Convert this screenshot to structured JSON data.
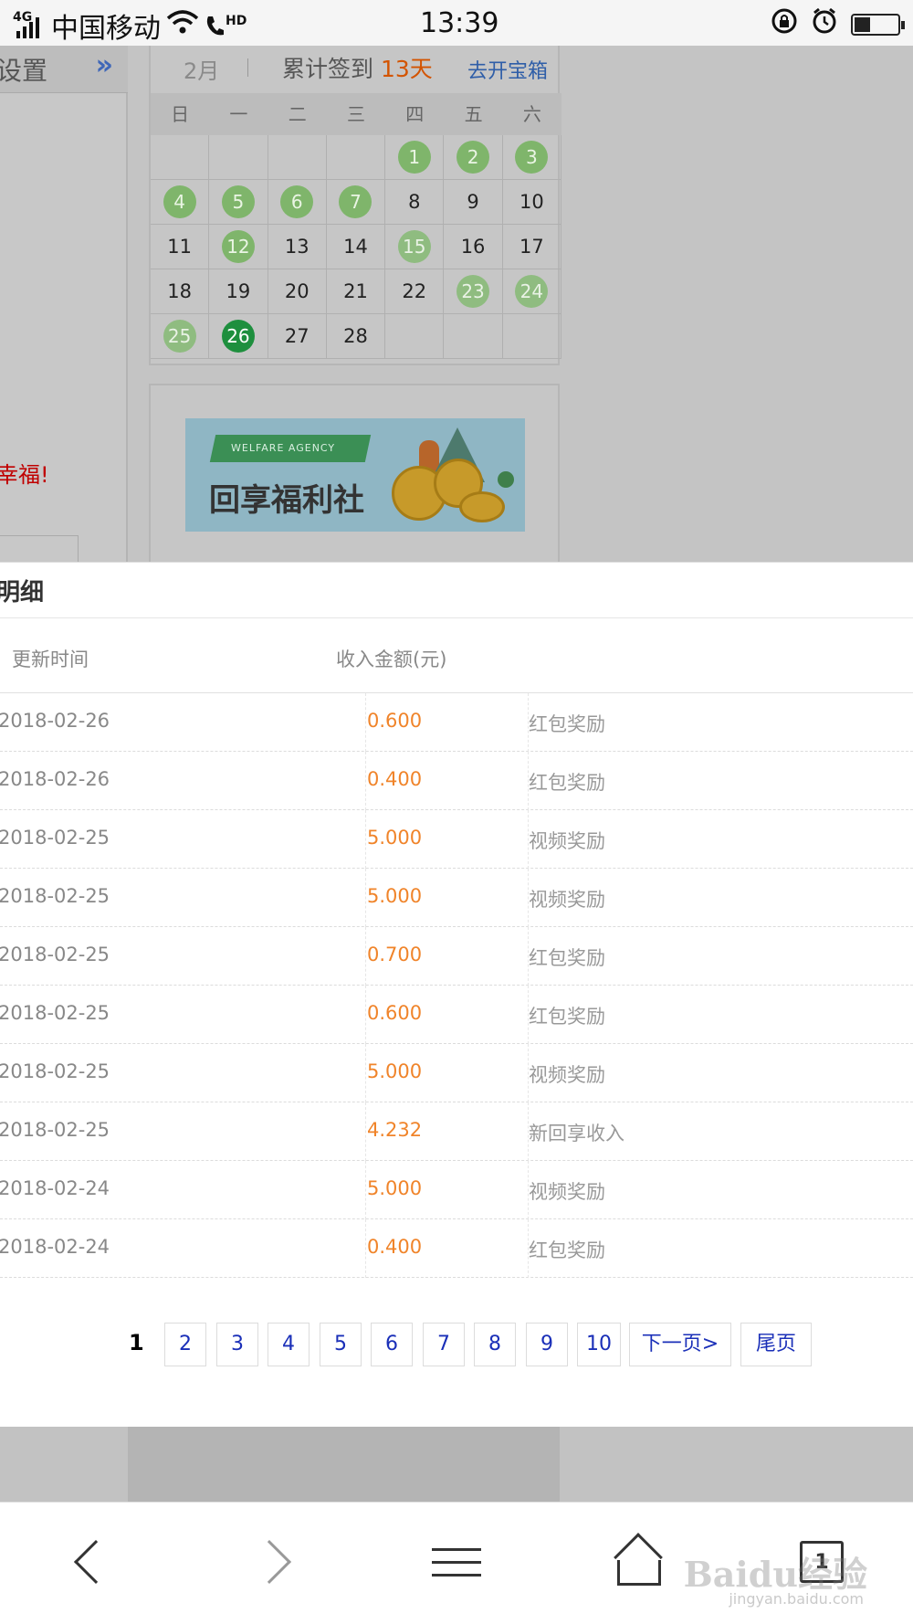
{
  "status_bar": {
    "signal_tag": "4G",
    "carrier": "中国移动",
    "hd_tag": "HD",
    "time": "13:39",
    "battery_fill": 0.35
  },
  "background_page": {
    "settings_label": "设置",
    "expand_glyph": "»",
    "red_note": "幸福!",
    "calendar": {
      "month": "2月",
      "total_prefix": "累计签到 ",
      "total_days": "13天",
      "chest_link": "去开宝箱",
      "weekdays": [
        "日",
        "一",
        "二",
        "三",
        "四",
        "五",
        "六"
      ],
      "cells": [
        {
          "day": "",
          "signed": false
        },
        {
          "day": "",
          "signed": false
        },
        {
          "day": "",
          "signed": false
        },
        {
          "day": "",
          "signed": false
        },
        {
          "day": "1",
          "signed": true
        },
        {
          "day": "2",
          "signed": true
        },
        {
          "day": "3",
          "signed": true
        },
        {
          "day": "4",
          "signed": true
        },
        {
          "day": "5",
          "signed": true
        },
        {
          "day": "6",
          "signed": true
        },
        {
          "day": "7",
          "signed": true
        },
        {
          "day": "8",
          "signed": false
        },
        {
          "day": "9",
          "signed": false
        },
        {
          "day": "10",
          "signed": false
        },
        {
          "day": "11",
          "signed": false
        },
        {
          "day": "12",
          "signed": true
        },
        {
          "day": "13",
          "signed": false
        },
        {
          "day": "14",
          "signed": false
        },
        {
          "day": "15",
          "signed": true
        },
        {
          "day": "16",
          "signed": false
        },
        {
          "day": "17",
          "signed": false
        },
        {
          "day": "18",
          "signed": false
        },
        {
          "day": "19",
          "signed": false
        },
        {
          "day": "20",
          "signed": false
        },
        {
          "day": "21",
          "signed": false
        },
        {
          "day": "22",
          "signed": false
        },
        {
          "day": "23",
          "signed": true
        },
        {
          "day": "24",
          "signed": true
        },
        {
          "day": "25",
          "signed": true
        },
        {
          "day": "26",
          "signed": true,
          "today": true
        },
        {
          "day": "27",
          "signed": false
        },
        {
          "day": "28",
          "signed": false
        },
        {
          "day": "",
          "signed": false
        },
        {
          "day": "",
          "signed": false
        },
        {
          "day": "",
          "signed": false
        }
      ]
    },
    "banner": {
      "ribbon_text": "WELFARE AGENCY",
      "title": "回享福利社"
    }
  },
  "sheet": {
    "title": "明细",
    "columns": [
      "更新时间",
      "收入金额(元)"
    ],
    "rows": [
      {
        "date": "2018-02-26",
        "amount": "0.600",
        "type": "红包奖励"
      },
      {
        "date": "2018-02-26",
        "amount": "0.400",
        "type": "红包奖励"
      },
      {
        "date": "2018-02-25",
        "amount": "5.000",
        "type": "视频奖励"
      },
      {
        "date": "2018-02-25",
        "amount": "5.000",
        "type": "视频奖励"
      },
      {
        "date": "2018-02-25",
        "amount": "0.700",
        "type": "红包奖励"
      },
      {
        "date": "2018-02-25",
        "amount": "0.600",
        "type": "红包奖励"
      },
      {
        "date": "2018-02-25",
        "amount": "5.000",
        "type": "视频奖励"
      },
      {
        "date": "2018-02-25",
        "amount": "4.232",
        "type": "新回享收入"
      },
      {
        "date": "2018-02-24",
        "amount": "5.000",
        "type": "视频奖励"
      },
      {
        "date": "2018-02-24",
        "amount": "0.400",
        "type": "红包奖励"
      }
    ],
    "pagination": {
      "current": "1",
      "pages": [
        "2",
        "3",
        "4",
        "5",
        "6",
        "7",
        "8",
        "9",
        "10"
      ],
      "next": "下一页>",
      "last": "尾页"
    }
  },
  "bottom_nav": {
    "tabs_count": "1",
    "watermark": "Baidu经验",
    "watermark_sub": "jingyan.baidu.com"
  }
}
